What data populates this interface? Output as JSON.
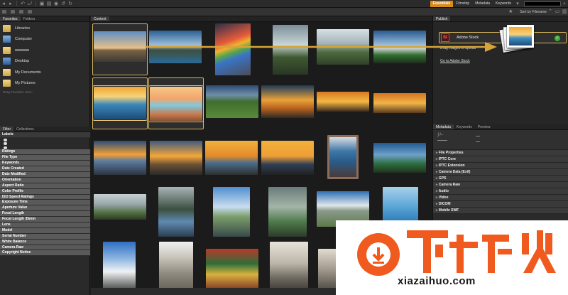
{
  "toolbar": {
    "workspaces": [
      "Essentials",
      "Filmstrip",
      "Metadata",
      "Keywords"
    ],
    "active_workspace": "Essentials",
    "sort_label": "Sort by Filename"
  },
  "left_panel": {
    "tabs": [
      "Favorites",
      "Folders"
    ],
    "favorites": [
      {
        "label": "Libraries",
        "icon": "libraries-icon"
      },
      {
        "label": "Computer",
        "icon": "computer-icon"
      },
      {
        "label": "",
        "icon": "user-folder-icon"
      },
      {
        "label": "Desktop",
        "icon": "desktop-icon"
      },
      {
        "label": "My Documents",
        "icon": "documents-icon"
      },
      {
        "label": "My Pictures",
        "icon": "pictures-icon"
      }
    ],
    "favorites_hint": "Drag Favorites Here...",
    "filter_tabs": [
      "Filter",
      "Collections"
    ],
    "filter_categories": [
      "Labels",
      "Ratings",
      "File Type",
      "Keywords",
      "Date Created",
      "Date Modified",
      "Orientation",
      "Aspect Ratio",
      "Color Profile",
      "ISO Speed Ratings",
      "Exposure Time",
      "Aperture Value",
      "Focal Length",
      "Focal Length 35mm",
      "Lens",
      "Model",
      "Serial Number",
      "White Balance",
      "Camera Raw",
      "Copyright Notice"
    ]
  },
  "content": {
    "tab": "Content"
  },
  "right_panel": {
    "publish_tab": "Publish",
    "stock_label": "Adobe Stock",
    "drag_hint": "Drag images to upload",
    "stock_link": "Go to Adobe Stock",
    "meta_tabs": [
      "Metadata",
      "Keywords",
      "Preview"
    ],
    "meta_sections": [
      "File Properties",
      "IPTC Core",
      "IPTC Extension",
      "Camera Data (Exif)",
      "GPS",
      "Camera Raw",
      "Audio",
      "Video",
      "DICOM",
      "Mobile SWF"
    ]
  },
  "watermark": {
    "text": "xiazaihuo.com",
    "logo_text": "下载火"
  },
  "colors": {
    "accent": "#d88a1a",
    "selection": "#d9b75a",
    "watermark_orange": "#f05a1e"
  }
}
